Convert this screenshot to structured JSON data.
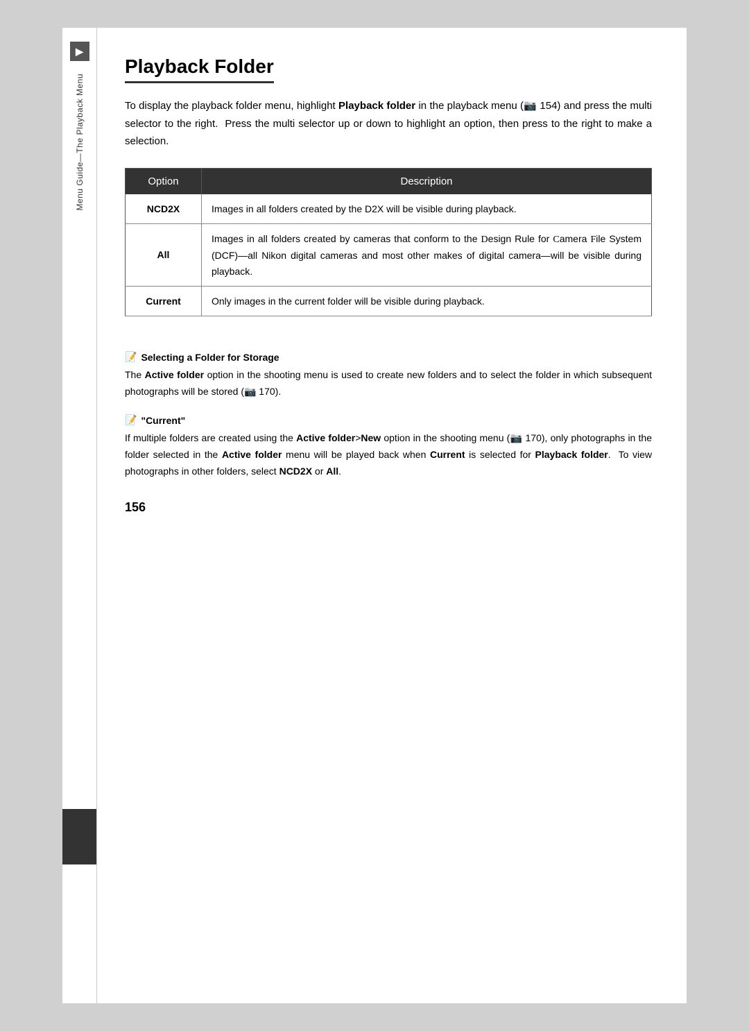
{
  "page": {
    "number": "156",
    "title": "Playback Folder",
    "intro": {
      "part1": "To display the playback folder menu, highlight ",
      "bold1": "Playback folder",
      "part2": " in the playback menu (",
      "ref1": "154",
      "part3": ") and press the multi selector to the right.  Press the multi selector up or down to highlight an option, then press to the right to make a selection."
    },
    "table": {
      "col_option": "Option",
      "col_description": "Description",
      "rows": [
        {
          "option": "NCD2X",
          "description": "Images in all folders created by the D2X will be visible during playback."
        },
        {
          "option": "All",
          "description": "Images in all folders created by cameras that conform to the Design Rule for Camera File System (DCF)—all Nikon digital cameras and most other makes of digital camera—will be visible during playback."
        },
        {
          "option": "Current",
          "description": "Only images in the current folder will be visible during playback."
        }
      ]
    },
    "notes": [
      {
        "id": "selecting-folder",
        "title": "Selecting a Folder for Storage",
        "body_parts": [
          "The ",
          {
            "bold": "Active folder"
          },
          " option in the shooting menu is used to create new folders and to select the folder in which subsequent photographs will be stored (",
          {
            "ref": "170"
          },
          ")."
        ]
      },
      {
        "id": "current-note",
        "title": "\"Current\"",
        "body_parts": [
          "If multiple folders are created using the ",
          {
            "bold": "Active folder"
          },
          ">",
          {
            "bold": "New"
          },
          " option in the shooting menu (",
          {
            "ref": "170"
          },
          "), only photographs in the folder selected in the ",
          {
            "bold": "Active folder"
          },
          " menu will be played back when ",
          {
            "bold": "Current"
          },
          " is selected for ",
          {
            "bold": "Playback folder"
          },
          ".  To view photographs in other folders, select ",
          {
            "bold": "NCD2X"
          },
          " or ",
          {
            "bold": "All"
          },
          "."
        ]
      }
    ],
    "sidebar": {
      "icon_symbol": "▶",
      "label": "Menu Guide—The Playback Menu"
    }
  }
}
